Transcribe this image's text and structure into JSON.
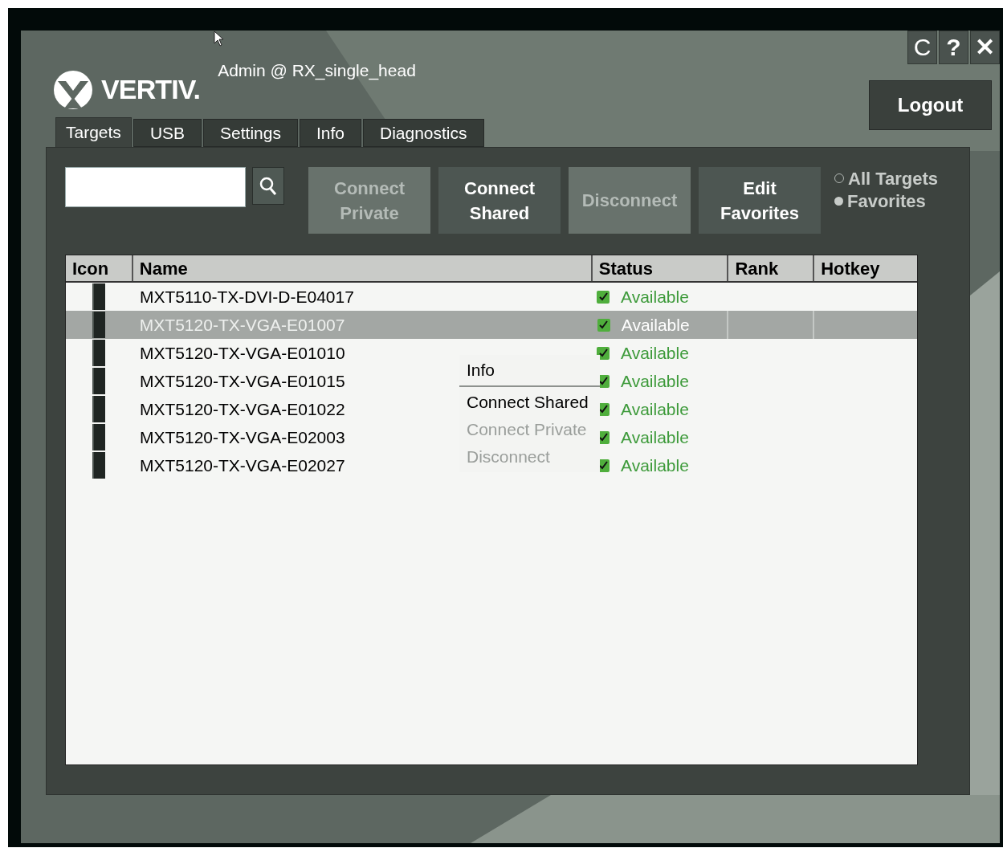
{
  "session": {
    "user_label": "Admin @ RX_single_head",
    "logo_text": "VERTIV."
  },
  "window_controls": [
    {
      "kind": "refresh",
      "label": "C"
    },
    {
      "kind": "help",
      "label": "?"
    },
    {
      "kind": "close",
      "label": "✕"
    }
  ],
  "logout_button": "Logout",
  "tabs": [
    {
      "label": "Targets",
      "selected": true
    },
    {
      "label": "USB",
      "selected": false
    },
    {
      "label": "Settings",
      "selected": false
    },
    {
      "label": "Info",
      "selected": false
    },
    {
      "label": "Diagnostics",
      "selected": false
    }
  ],
  "toolbar_buttons": [
    {
      "label": "Connect Private",
      "disabled": true
    },
    {
      "label": "Connect Shared",
      "disabled": false
    },
    {
      "label": "Disconnect",
      "disabled": true
    },
    {
      "label": "Edit Favorites",
      "disabled": false
    }
  ],
  "filter": [
    {
      "label": "All Targets",
      "selected": false
    },
    {
      "label": "Favorites",
      "selected": true
    }
  ],
  "table": {
    "columns": [
      "Icon",
      "Name",
      "Status",
      "Rank",
      "Hotkey"
    ],
    "rows": [
      {
        "name": "MXT5110-TX-DVI-D-E04017",
        "status": "Available",
        "checked": true,
        "selected": false
      },
      {
        "name": "MXT5120-TX-VGA-E01007",
        "status": "Available",
        "checked": true,
        "selected": true
      },
      {
        "name": "MXT5120-TX-VGA-E01010",
        "status": "Available",
        "checked": true,
        "selected": false
      },
      {
        "name": "MXT5120-TX-VGA-E01015",
        "status": "Available",
        "checked": true,
        "selected": false
      },
      {
        "name": "MXT5120-TX-VGA-E01022",
        "status": "Available",
        "checked": true,
        "selected": false
      },
      {
        "name": "MXT5120-TX-VGA-E02003",
        "status": "Available",
        "checked": true,
        "selected": false
      },
      {
        "name": "MXT5120-TX-VGA-E02027",
        "status": "Available",
        "checked": true,
        "selected": false
      }
    ]
  },
  "context_menu": [
    {
      "label": "Info",
      "disabled": false
    },
    {
      "kind": "separator"
    },
    {
      "label": "Connect Shared",
      "disabled": false
    },
    {
      "label": "Connect Private",
      "disabled": true
    },
    {
      "label": "Disconnect",
      "disabled": true
    }
  ]
}
